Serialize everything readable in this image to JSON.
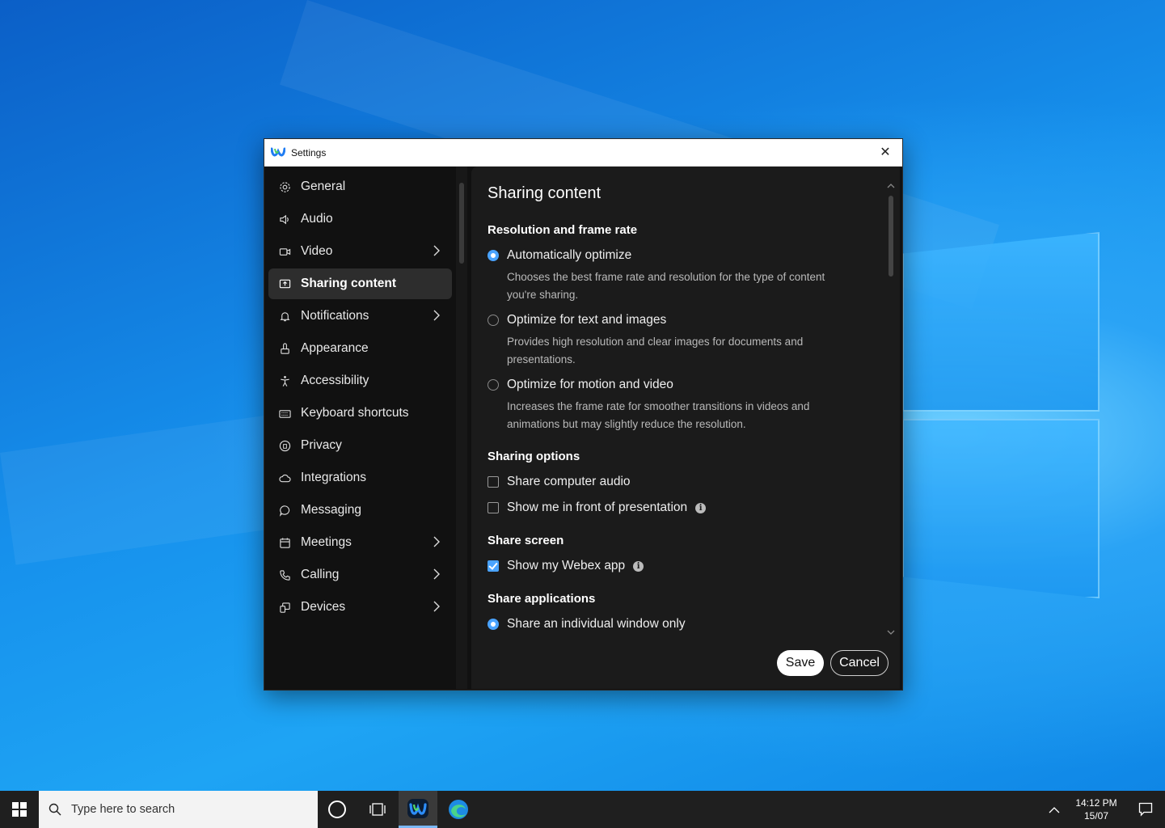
{
  "window": {
    "title": "Settings"
  },
  "sidebar": {
    "items": [
      {
        "label": "General",
        "icon": "gear-icon",
        "chevron": false,
        "active": false
      },
      {
        "label": "Audio",
        "icon": "speaker-icon",
        "chevron": false,
        "active": false
      },
      {
        "label": "Video",
        "icon": "camera-icon",
        "chevron": true,
        "active": false
      },
      {
        "label": "Sharing content",
        "icon": "share-screen-icon",
        "chevron": false,
        "active": true
      },
      {
        "label": "Notifications",
        "icon": "bell-icon",
        "chevron": true,
        "active": false
      },
      {
        "label": "Appearance",
        "icon": "paintbrush-icon",
        "chevron": false,
        "active": false
      },
      {
        "label": "Accessibility",
        "icon": "accessibility-icon",
        "chevron": false,
        "active": false
      },
      {
        "label": "Keyboard shortcuts",
        "icon": "keyboard-icon",
        "chevron": false,
        "active": false
      },
      {
        "label": "Privacy",
        "icon": "privacy-icon",
        "chevron": false,
        "active": false
      },
      {
        "label": "Integrations",
        "icon": "cloud-icon",
        "chevron": false,
        "active": false
      },
      {
        "label": "Messaging",
        "icon": "chat-bubble-icon",
        "chevron": false,
        "active": false
      },
      {
        "label": "Meetings",
        "icon": "calendar-icon",
        "chevron": true,
        "active": false
      },
      {
        "label": "Calling",
        "icon": "phone-icon",
        "chevron": true,
        "active": false
      },
      {
        "label": "Devices",
        "icon": "devices-icon",
        "chevron": true,
        "active": false
      }
    ]
  },
  "content": {
    "title": "Sharing content",
    "resolution": {
      "heading": "Resolution and frame rate",
      "options": [
        {
          "label": "Automatically optimize",
          "selected": true,
          "desc": "Chooses the best frame rate and resolution for the type of content you're sharing."
        },
        {
          "label": "Optimize for text and images",
          "selected": false,
          "desc": "Provides high resolution and clear images for documents and presentations."
        },
        {
          "label": "Optimize for motion and video",
          "selected": false,
          "desc": "Increases the frame rate for smoother transitions in videos and animations but may slightly reduce the resolution."
        }
      ]
    },
    "sharing_options": {
      "heading": "Sharing options",
      "share_audio": {
        "label": "Share computer audio",
        "checked": false
      },
      "show_me": {
        "label": "Show me in front of presentation",
        "checked": false
      }
    },
    "share_screen": {
      "heading": "Share screen",
      "show_app": {
        "label": "Show my Webex app",
        "checked": true
      }
    },
    "share_apps": {
      "heading": "Share applications",
      "individual": {
        "label": "Share an individual window only",
        "selected": true
      }
    },
    "buttons": {
      "save": "Save",
      "cancel": "Cancel"
    }
  },
  "taskbar": {
    "search_placeholder": "Type here to search",
    "time": "14:12 PM",
    "date": "15/07"
  },
  "colors": {
    "accent": "#4aa3ff",
    "active_nav": "#2d2d2d",
    "panel": "#1b1b1b"
  }
}
